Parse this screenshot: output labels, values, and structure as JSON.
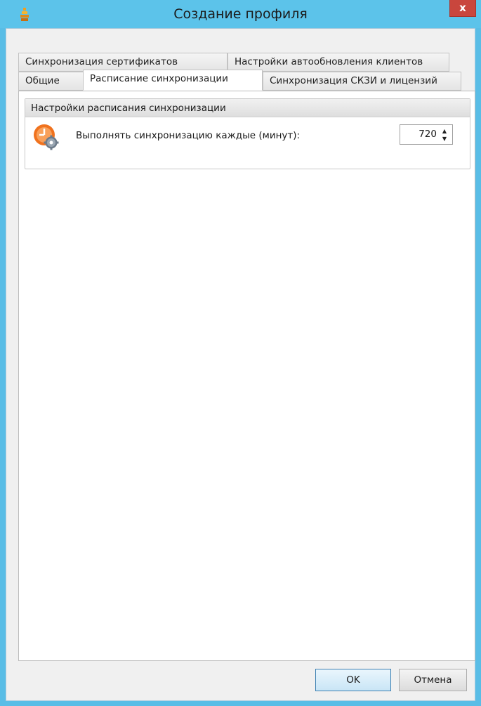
{
  "window": {
    "title": "Создание профиля",
    "close_label": "x"
  },
  "tabs": {
    "row1": [
      {
        "label": "Синхронизация сертификатов"
      },
      {
        "label": "Настройки автообновления клиентов"
      }
    ],
    "row2": [
      {
        "label": "Общие"
      },
      {
        "label": "Расписание синхронизации",
        "active": true
      },
      {
        "label": "Синхронизация СКЗИ и лицензий"
      }
    ]
  },
  "schedule": {
    "group_title": "Настройки расписания синхронизации",
    "interval_label": "Выполнять синхронизацию каждые (минут):",
    "interval_value": "720",
    "icon": "clock-gear-icon"
  },
  "buttons": {
    "ok": "OK",
    "cancel": "Отмена"
  },
  "colors": {
    "titlebar": "#5cc3ea",
    "close": "#c9463d",
    "icon_orange": "#f0721e"
  }
}
